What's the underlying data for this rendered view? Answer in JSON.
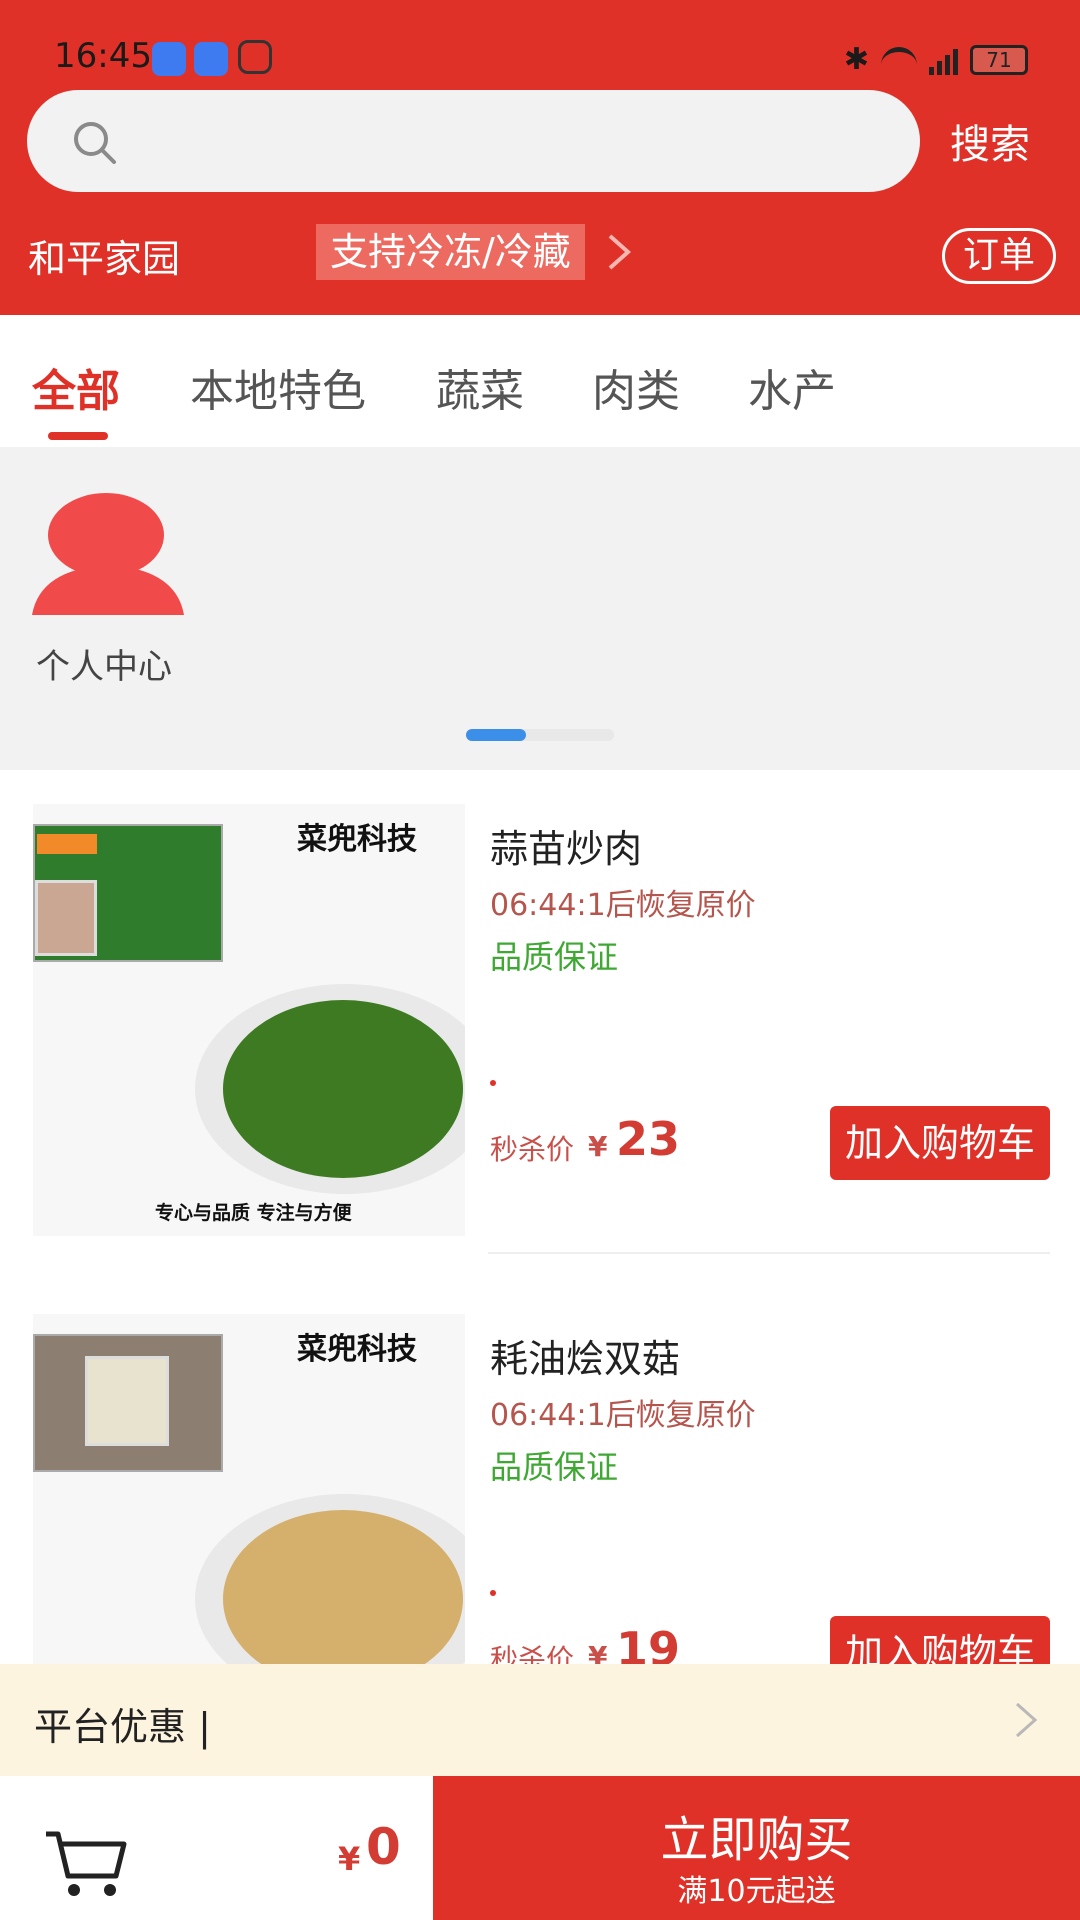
{
  "status_bar": {
    "time": "16:45",
    "battery": "71",
    "network": "5G"
  },
  "header": {
    "search_placeholder": "",
    "search_button": "搜索",
    "location": "和平家园",
    "promo_tag": "支持冷冻/冷藏",
    "orders_button": "订单"
  },
  "tabs": [
    {
      "label": "全部",
      "active": true
    },
    {
      "label": "本地特色",
      "active": false
    },
    {
      "label": "蔬菜",
      "active": false
    },
    {
      "label": "肉类",
      "active": false
    },
    {
      "label": "水产",
      "active": false
    }
  ],
  "shortcuts": [
    {
      "label": "个人中心",
      "icon": "person-icon"
    }
  ],
  "products": [
    {
      "name": "蒜苗炒肉",
      "countdown": "06:44:1后恢复原价",
      "quality": "品质保证",
      "price_label": "秒杀价",
      "currency": "¥",
      "price": "23",
      "add_button": "加入购物车",
      "image_brand": "菜兜科技",
      "image_slogan": "专心与品质 专注与方便"
    },
    {
      "name": "耗油烩双菇",
      "countdown": "06:44:1后恢复原价",
      "quality": "品质保证",
      "price_label": "秒杀价",
      "currency": "¥",
      "price": "19",
      "add_button": "加入购物车",
      "image_brand": "菜兜科技",
      "image_slogan": ""
    }
  ],
  "coupon": {
    "label": "平台优惠 |"
  },
  "cart": {
    "currency": "¥",
    "total": "0",
    "buy_button": "立即购买",
    "min_order": "满10元起送"
  },
  "colors": {
    "brand_red": "#e03128",
    "quality_green": "#3ea833",
    "pager_blue": "#3c8fe8"
  }
}
